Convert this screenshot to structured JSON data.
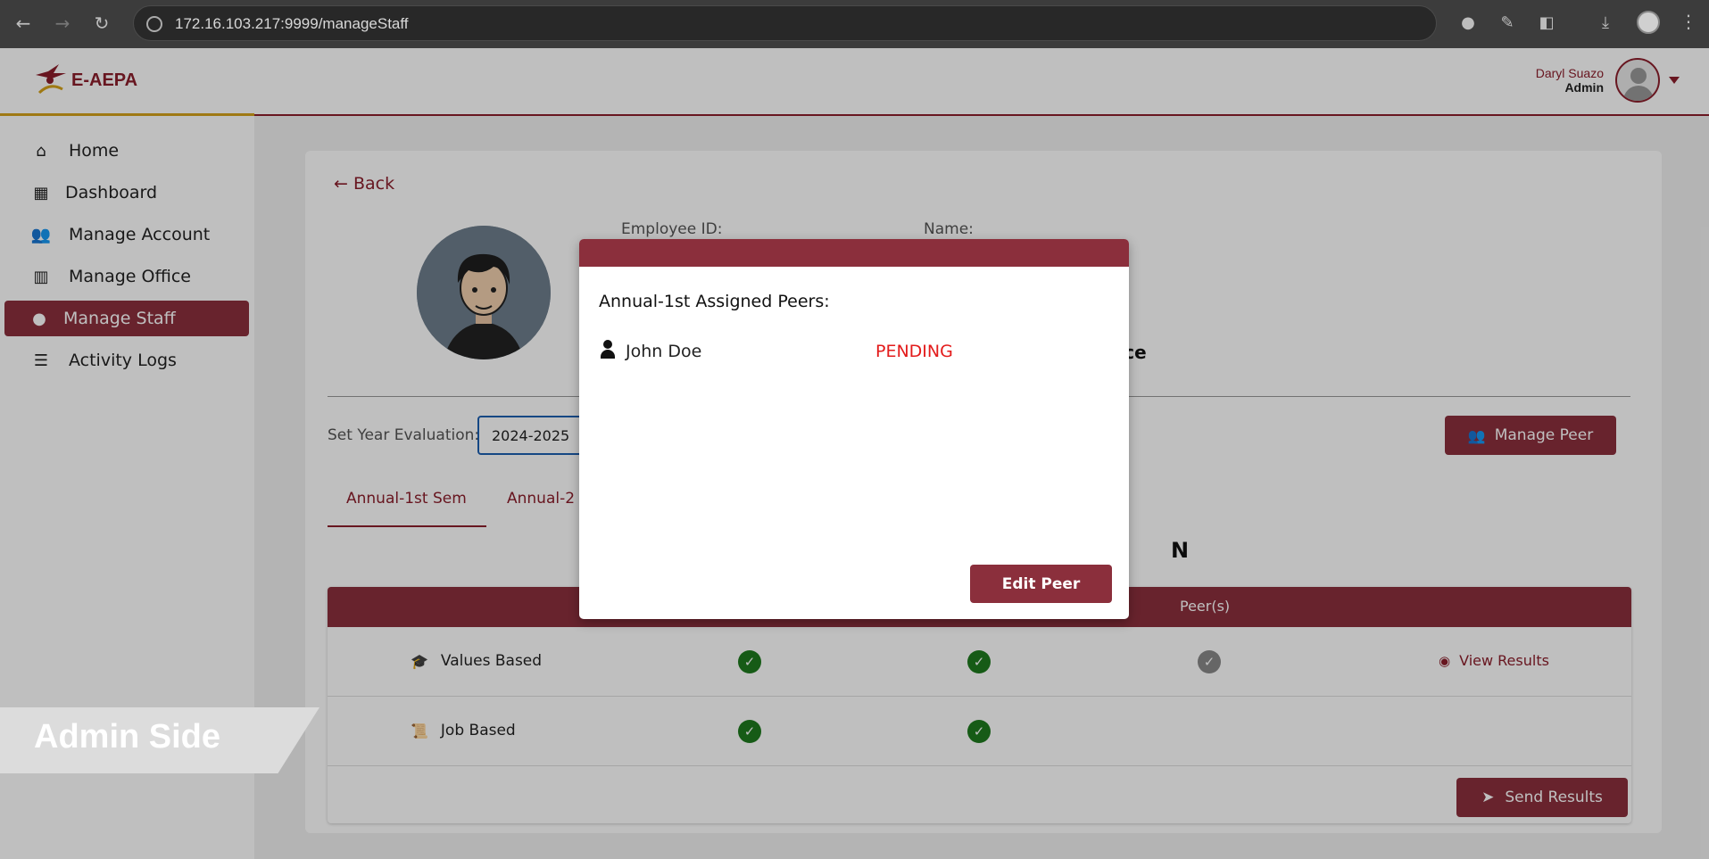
{
  "browser": {
    "url": "172.16.103.217:9999/manageStaff"
  },
  "header": {
    "logo_text": "E-AEPA",
    "user_name": "Daryl Suazo",
    "user_role": "Admin"
  },
  "sidebar": {
    "items": [
      {
        "label": "Home",
        "icon": "home-icon"
      },
      {
        "label": "Dashboard",
        "icon": "dashboard-icon"
      },
      {
        "label": "Manage Account",
        "icon": "users-icon"
      },
      {
        "label": "Manage Office",
        "icon": "building-icon"
      },
      {
        "label": "Manage Staff",
        "icon": "staff-icon",
        "active": true
      },
      {
        "label": "Activity Logs",
        "icon": "list-icon"
      }
    ]
  },
  "main": {
    "back_label": "Back",
    "employee_id_label": "Employee ID:",
    "name_label": "Name:",
    "office_partial": "ffice",
    "year_label": "Set Year Evaluation:",
    "year_value": "2024-2025",
    "manage_peer_label": "Manage Peer",
    "tabs": [
      {
        "label": "Annual-1st Sem",
        "active": true
      },
      {
        "label": "Annual-2"
      }
    ],
    "partial_heading": "N",
    "table": {
      "header_peers": "Peer(s)",
      "rows": [
        {
          "label": "Values Based",
          "icon": "graduation-cap-icon",
          "checks": [
            "green",
            "green",
            "grey"
          ],
          "view_results": "View Results"
        },
        {
          "label": "Job Based",
          "icon": "scroll-icon",
          "checks": [
            "green",
            "green"
          ]
        }
      ]
    },
    "send_results_label": "Send Results"
  },
  "modal": {
    "title": "Annual-1st Assigned Peers:",
    "peers": [
      {
        "name": "John Doe",
        "status": "PENDING"
      }
    ],
    "edit_peer_label": "Edit Peer"
  },
  "banner": {
    "text": "Admin Side"
  },
  "colors": {
    "brand": "#8b2f3c",
    "accent_gold": "#d4a21a",
    "pending": "#e31b1b",
    "check_green": "#1e7a1e"
  }
}
